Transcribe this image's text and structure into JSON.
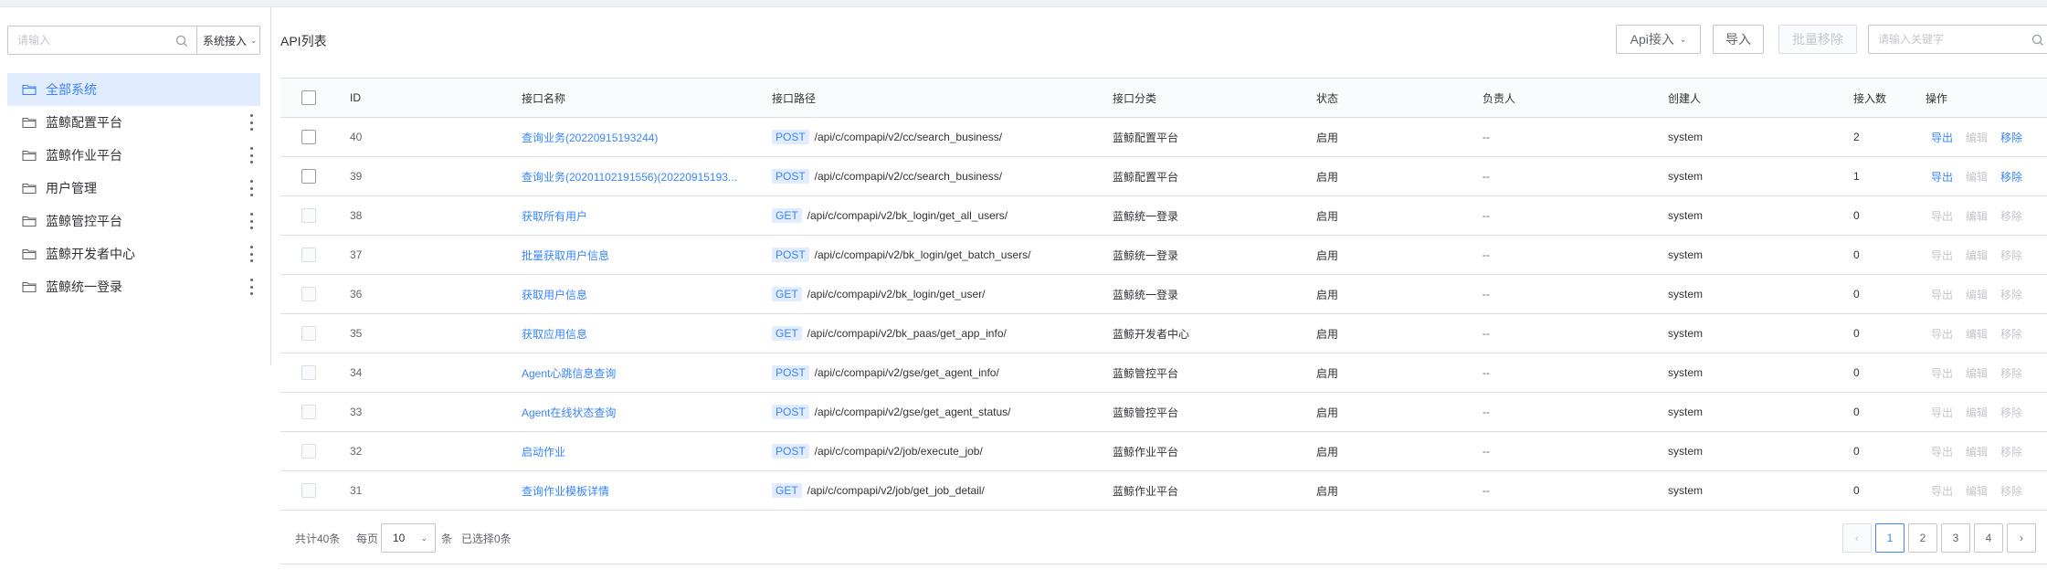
{
  "sidebar": {
    "search_placeholder": "请输入",
    "select_value": "系统接入",
    "items": [
      {
        "label": "全部系统",
        "active": true
      },
      {
        "label": "蓝鲸配置平台"
      },
      {
        "label": "蓝鲸作业平台"
      },
      {
        "label": "用户管理"
      },
      {
        "label": "蓝鲸管控平台"
      },
      {
        "label": "蓝鲸开发者中心"
      },
      {
        "label": "蓝鲸统一登录"
      }
    ]
  },
  "header": {
    "title": "API列表",
    "api_access_label": "Api接入",
    "import_label": "导入",
    "batch_remove_label": "批量移除",
    "keyword_placeholder": "请输入关键字"
  },
  "table": {
    "columns": {
      "id": "ID",
      "name": "接口名称",
      "path": "接口路径",
      "category": "接口分类",
      "status": "状态",
      "owner": "负责人",
      "creator": "创建人",
      "access": "接入数",
      "ops": "操作"
    },
    "ops_labels": {
      "export": "导出",
      "edit": "编辑",
      "remove": "移除"
    },
    "rows": [
      {
        "id": "40",
        "name": "查询业务(20220915193244)",
        "method": "POST",
        "path": "/api/c/compapi/v2/cc/search_business/",
        "category": "蓝鲸配置平台",
        "status": "启用",
        "owner": "--",
        "creator": "system",
        "access": "2",
        "enabled": true
      },
      {
        "id": "39",
        "name": "查询业务(20201102191556)(20220915193...",
        "method": "POST",
        "path": "/api/c/compapi/v2/cc/search_business/",
        "category": "蓝鲸配置平台",
        "status": "启用",
        "owner": "--",
        "creator": "system",
        "access": "1",
        "enabled": true
      },
      {
        "id": "38",
        "name": "获取所有用户",
        "method": "GET",
        "path": "/api/c/compapi/v2/bk_login/get_all_users/",
        "category": "蓝鲸统一登录",
        "status": "启用",
        "owner": "--",
        "creator": "system",
        "access": "0",
        "enabled": false
      },
      {
        "id": "37",
        "name": "批量获取用户信息",
        "method": "POST",
        "path": "/api/c/compapi/v2/bk_login/get_batch_users/",
        "category": "蓝鲸统一登录",
        "status": "启用",
        "owner": "--",
        "creator": "system",
        "access": "0",
        "enabled": false
      },
      {
        "id": "36",
        "name": "获取用户信息",
        "method": "GET",
        "path": "/api/c/compapi/v2/bk_login/get_user/",
        "category": "蓝鲸统一登录",
        "status": "启用",
        "owner": "--",
        "creator": "system",
        "access": "0",
        "enabled": false
      },
      {
        "id": "35",
        "name": "获取应用信息",
        "method": "GET",
        "path": "/api/c/compapi/v2/bk_paas/get_app_info/",
        "category": "蓝鲸开发者中心",
        "status": "启用",
        "owner": "--",
        "creator": "system",
        "access": "0",
        "enabled": false
      },
      {
        "id": "34",
        "name": "Agent心跳信息查询",
        "method": "POST",
        "path": "/api/c/compapi/v2/gse/get_agent_info/",
        "category": "蓝鲸管控平台",
        "status": "启用",
        "owner": "--",
        "creator": "system",
        "access": "0",
        "enabled": false
      },
      {
        "id": "33",
        "name": "Agent在线状态查询",
        "method": "POST",
        "path": "/api/c/compapi/v2/gse/get_agent_status/",
        "category": "蓝鲸管控平台",
        "status": "启用",
        "owner": "--",
        "creator": "system",
        "access": "0",
        "enabled": false
      },
      {
        "id": "32",
        "name": "启动作业",
        "method": "POST",
        "path": "/api/c/compapi/v2/job/execute_job/",
        "category": "蓝鲸作业平台",
        "status": "启用",
        "owner": "--",
        "creator": "system",
        "access": "0",
        "enabled": false
      },
      {
        "id": "31",
        "name": "查询作业模板详情",
        "method": "GET",
        "path": "/api/c/compapi/v2/job/get_job_detail/",
        "category": "蓝鲸作业平台",
        "status": "启用",
        "owner": "--",
        "creator": "system",
        "access": "0",
        "enabled": false
      }
    ]
  },
  "footer": {
    "total_text": "共计40条",
    "per_page_label": "每页",
    "page_size": "10",
    "unit": "条",
    "selected_text": "已选择0条",
    "prev": "‹",
    "next": "›",
    "pages": [
      "1",
      "2",
      "3",
      "4"
    ],
    "current_page": "1"
  },
  "colors": {
    "primary": "#3a84ff",
    "active_bg": "#e1ecff",
    "border": "#dcdee5",
    "disabled": "#c4c6cc"
  }
}
